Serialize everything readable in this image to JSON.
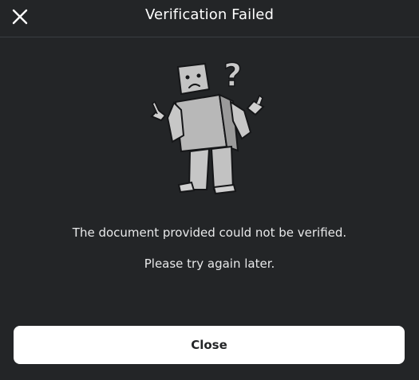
{
  "modal": {
    "title": "Verification Failed",
    "close_icon": "close-icon",
    "illustration": "confused-avatar-illustration",
    "messages": [
      "The document provided could not be verified.",
      "Please try again later."
    ],
    "primary_button_label": "Close"
  },
  "colors": {
    "background": "#232527",
    "divider": "#3a3d42",
    "text": "#ffffff",
    "button_bg": "#ffffff",
    "button_text": "#232527",
    "figure": "#bdbdbd"
  }
}
